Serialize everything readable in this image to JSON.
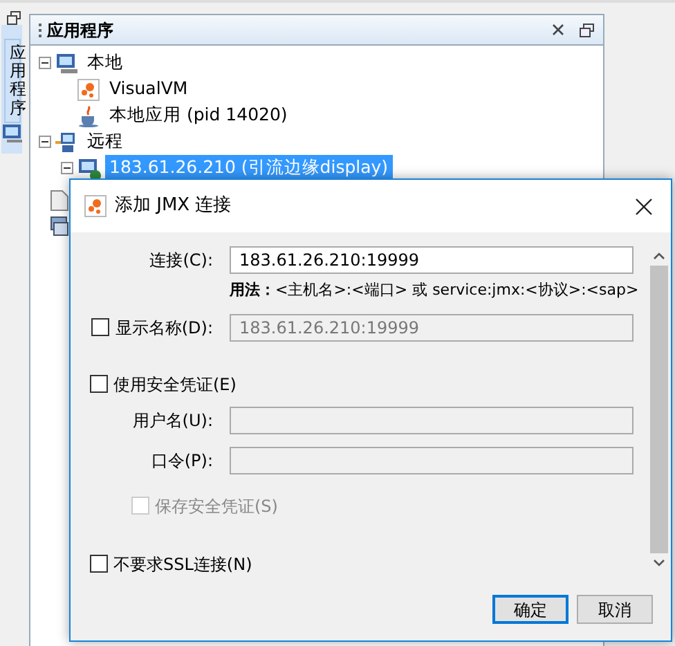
{
  "side_tab": {
    "label": "应用程序",
    "selected": true
  },
  "panel": {
    "title": "应用程序"
  },
  "tree": [
    {
      "label": "本地",
      "kind": "host",
      "expanded": true,
      "selected": false,
      "children": [
        {
          "label": "VisualVM",
          "kind": "visualvm",
          "selected": false
        },
        {
          "label": "本地应用 (pid 14020)",
          "kind": "java",
          "selected": false
        }
      ]
    },
    {
      "label": "远程",
      "kind": "remote",
      "expanded": true,
      "selected": false,
      "children": [
        {
          "label": "183.61.26.210 (引流边缘display)",
          "kind": "remote-host",
          "expanded": true,
          "selected": true
        }
      ]
    }
  ],
  "dialog": {
    "title": "添加 JMX 连接",
    "connection": {
      "label": "连接(C):",
      "value": "183.61.26.210:19999"
    },
    "usage": "**用法：**<主机名>:<端口> 或 service:jmx:<协议>:<sap>",
    "display_name": {
      "label": "显示名称(D):",
      "checked": false,
      "value": "183.61.26.210:19999",
      "disabled": true
    },
    "use_credentials": {
      "label": "使用安全凭证(E)",
      "checked": false
    },
    "username": {
      "label": "用户名(U):",
      "disabled": true
    },
    "password": {
      "label": "口令(P):",
      "disabled": true
    },
    "save_credentials": {
      "label": "保存安全凭证(S)",
      "checked": false,
      "disabled": true
    },
    "no_ssl": {
      "label": "不要求SSL连接(N)",
      "checked": false
    },
    "buttons": [
      {
        "label": "确定",
        "default": true
      },
      {
        "label": "取消",
        "default": false
      }
    ]
  }
}
